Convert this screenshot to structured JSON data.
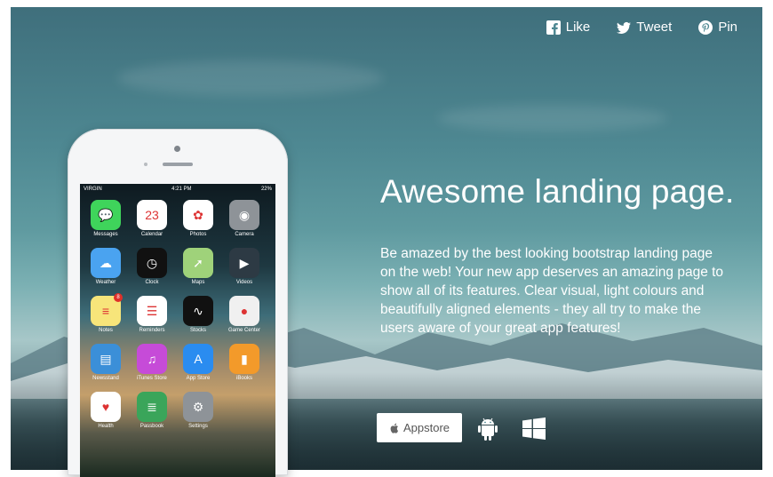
{
  "social": [
    {
      "icon": "facebook-icon",
      "label": "Like"
    },
    {
      "icon": "twitter-icon",
      "label": "Tweet"
    },
    {
      "icon": "pinterest-icon",
      "label": "Pin"
    }
  ],
  "hero": {
    "title": "Awesome landing page.",
    "description": "Be amazed by the best looking bootstrap landing page on the web! Your new app deserves an amazing page to show all of its features. Clear visual, light colours and beautifully aligned elements - they all try to make the users aware of your great app features!"
  },
  "downloads": {
    "appstore_label": "Appstore",
    "android_icon": "android-icon",
    "windows_icon": "windows-icon"
  },
  "phone": {
    "carrier": "VIRGIN",
    "time": "4:21 PM",
    "battery": "22%",
    "apps": [
      {
        "label": "Messages",
        "icon": "messages-icon",
        "color": "#3fd45b",
        "glyph": "💬"
      },
      {
        "label": "Calendar",
        "icon": "calendar-icon",
        "color": "#ffffff",
        "glyph": "23"
      },
      {
        "label": "Photos",
        "icon": "photos-icon",
        "color": "#ffffff",
        "glyph": "✿"
      },
      {
        "label": "Camera",
        "icon": "camera-icon",
        "color": "#8e9398",
        "glyph": "◉"
      },
      {
        "label": "Weather",
        "icon": "weather-icon",
        "color": "#4aa3f0",
        "glyph": "☁"
      },
      {
        "label": "Clock",
        "icon": "clock-icon",
        "color": "#111111",
        "glyph": "◷"
      },
      {
        "label": "Maps",
        "icon": "maps-icon",
        "color": "#9fd27a",
        "glyph": "➚"
      },
      {
        "label": "Videos",
        "icon": "videos-icon",
        "color": "#2d3a44",
        "glyph": "▶"
      },
      {
        "label": "Notes",
        "icon": "notes-icon",
        "color": "#f7e57a",
        "glyph": "≡",
        "badge": "8"
      },
      {
        "label": "Reminders",
        "icon": "reminders-icon",
        "color": "#ffffff",
        "glyph": "☰"
      },
      {
        "label": "Stocks",
        "icon": "stocks-icon",
        "color": "#111111",
        "glyph": "∿"
      },
      {
        "label": "Game Center",
        "icon": "game-center-icon",
        "color": "#f0f0f0",
        "glyph": "●"
      },
      {
        "label": "Newsstand",
        "icon": "newsstand-icon",
        "color": "#3b8fd8",
        "glyph": "▤"
      },
      {
        "label": "iTunes Store",
        "icon": "itunes-icon",
        "color": "#c64bd8",
        "glyph": "♫"
      },
      {
        "label": "App Store",
        "icon": "app-store-icon",
        "color": "#2a8cf0",
        "glyph": "A"
      },
      {
        "label": "iBooks",
        "icon": "ibooks-icon",
        "color": "#f39a2a",
        "glyph": "▮"
      },
      {
        "label": "Health",
        "icon": "health-icon",
        "color": "#ffffff",
        "glyph": "♥"
      },
      {
        "label": "Passbook",
        "icon": "passbook-icon",
        "color": "#3aa55a",
        "glyph": "≣"
      },
      {
        "label": "Settings",
        "icon": "settings-icon",
        "color": "#8e9398",
        "glyph": "⚙"
      }
    ]
  }
}
